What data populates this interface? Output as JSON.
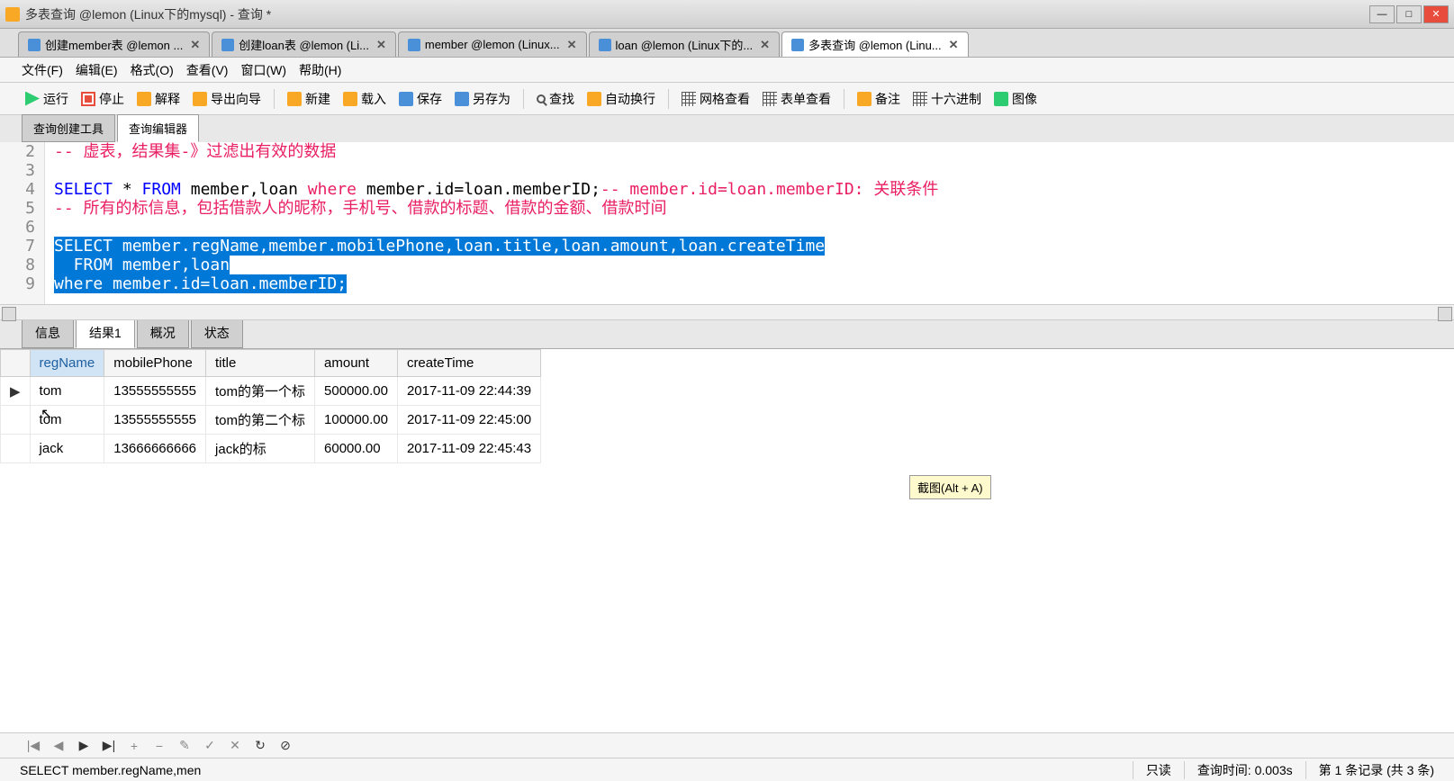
{
  "title": "多表查询 @lemon (Linux下的mysql) - 查询 *",
  "tabs": [
    {
      "label": "创建member表 @lemon ..."
    },
    {
      "label": "创建loan表 @lemon (Li..."
    },
    {
      "label": "member @lemon (Linux..."
    },
    {
      "label": "loan @lemon (Linux下的..."
    },
    {
      "label": "多表查询 @lemon (Linu..."
    }
  ],
  "menu": {
    "file": "文件(F)",
    "edit": "编辑(E)",
    "format": "格式(O)",
    "view": "查看(V)",
    "window": "窗口(W)",
    "help": "帮助(H)"
  },
  "toolbar": {
    "run": "运行",
    "stop": "停止",
    "explain": "解释",
    "export": "导出向导",
    "new": "新建",
    "load": "载入",
    "save": "保存",
    "saveas": "另存为",
    "find": "查找",
    "wrap": "自动换行",
    "gridview": "网格查看",
    "formview": "表单查看",
    "note": "备注",
    "hex": "十六进制",
    "image": "图像"
  },
  "subtabs": {
    "builder": "查询创建工具",
    "editor": "查询编辑器"
  },
  "code": {
    "l2": "-- 虚表，结果集-》过滤出有效的数据",
    "l3": "",
    "l4a": "SELECT",
    "l4b": " * ",
    "l4c": "FROM",
    "l4d": " member,loan ",
    "l4e": "where",
    "l4f": " member.id=loan.memberID;",
    "l4g": "-- member.id=loan.memberID: 关联条件",
    "l5": "-- 所有的标信息，包括借款人的昵称，手机号、借款的标题、借款的金额、借款时间",
    "l6": "",
    "l7": "SELECT member.regName,member.mobilePhone,loan.title,loan.amount,loan.createTime",
    "l8a": "  FROM member,loan",
    "l9": "where member.id=loan.memberID;"
  },
  "restabs": {
    "info": "信息",
    "r1": "结果1",
    "profile": "概况",
    "status": "状态"
  },
  "cols": {
    "c0": "regName",
    "c1": "mobilePhone",
    "c2": "title",
    "c3": "amount",
    "c4": "createTime"
  },
  "rows": [
    {
      "regName": "tom",
      "mobilePhone": "13555555555",
      "title": "tom的第一个标",
      "amount": "500000.00",
      "createTime": "2017-11-09 22:44:39"
    },
    {
      "regName": "tom",
      "mobilePhone": "13555555555",
      "title": "tom的第二个标",
      "amount": "100000.00",
      "createTime": "2017-11-09 22:45:00"
    },
    {
      "regName": "jack",
      "mobilePhone": "13666666666",
      "title": "jack的标",
      "amount": "60000.00",
      "createTime": "2017-11-09 22:45:43"
    }
  ],
  "tooltip": "截图(Alt + A)",
  "status": {
    "query": "SELECT member.regName,men",
    "mode": "只读",
    "time": "查询时间: 0.003s",
    "records": "第 1 条记录 (共 3 条)"
  }
}
